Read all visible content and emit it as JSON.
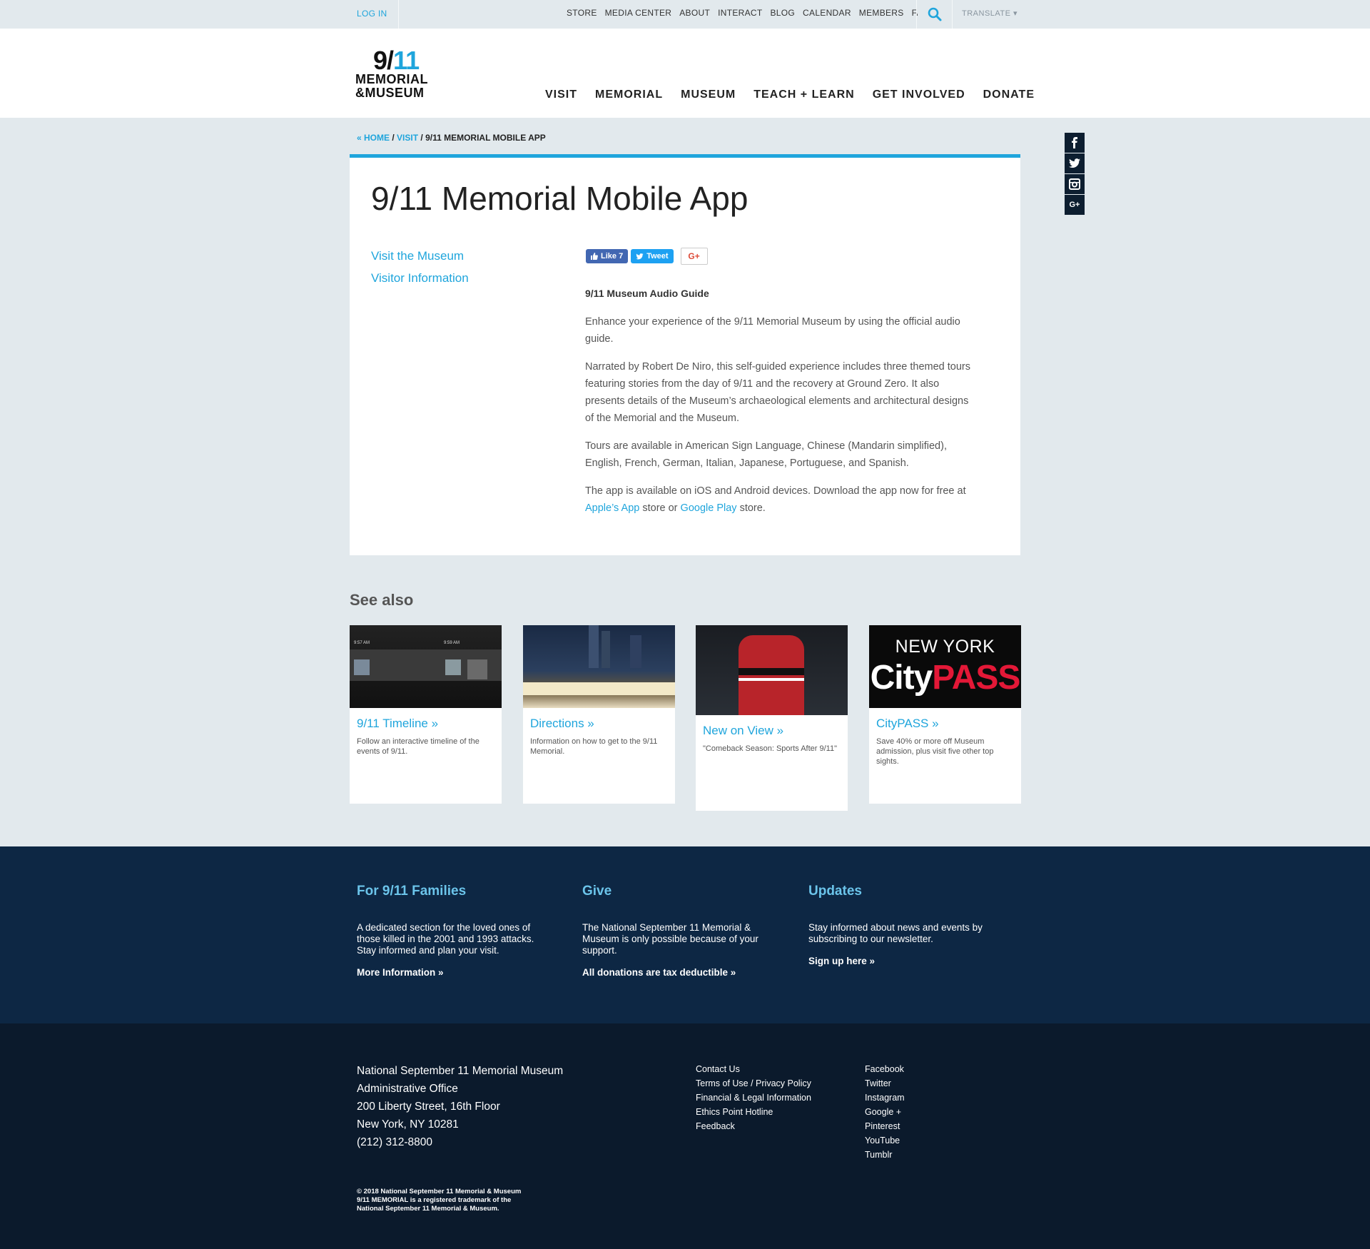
{
  "utility_bar": {
    "login": "LOG IN",
    "links": [
      "STORE",
      "MEDIA CENTER",
      "ABOUT",
      "INTERACT",
      "BLOG",
      "CALENDAR",
      "MEMBERS",
      "FAQ"
    ],
    "translate": "TRANSLATE ▾"
  },
  "logo": {
    "line1a": "9/",
    "line1b": "11",
    "line2": "MEMORIAL",
    "line3": "&MUSEUM"
  },
  "main_nav": [
    "VISIT",
    "MEMORIAL",
    "MUSEUM",
    "TEACH + LEARN",
    "GET INVOLVED",
    "DONATE"
  ],
  "breadcrumb": {
    "home": "« HOME",
    "visit": "VISIT",
    "current": "9/11 MEMORIAL MOBILE APP"
  },
  "social_side": [
    "f",
    "t",
    "ig",
    "G+"
  ],
  "page_title": "9/11 Memorial Mobile App",
  "side_links": [
    "Visit the Museum",
    "Visitor Information"
  ],
  "share": {
    "like": "Like 7",
    "tweet": "Tweet",
    "gplus": "G+"
  },
  "article": {
    "heading": "9/11 Museum Audio Guide",
    "p1": "Enhance your experience of the 9/11 Memorial Museum by using the official audio guide.",
    "p2": "Narrated by Robert De Niro, this self-guided experience includes three themed tours featuring stories from the day of 9/11 and the recovery at Ground Zero. It also presents details of the Museum’s archaeological elements and architectural designs of the Memorial and the Museum.",
    "p3": "Tours are available in American Sign Language, Chinese (Mandarin simplified), English, French, German, Italian, Japanese, Portuguese, and Spanish.",
    "p4_a": "The app is available on iOS and Android devices. Download the app now for free at ",
    "p4_link1": "Apple’s App",
    "p4_b": " store or ",
    "p4_link2": "Google Play",
    "p4_c": " store."
  },
  "see_also": {
    "title": "See also",
    "tiles": [
      {
        "title": "9/11 Timeline »",
        "desc": "Follow an interactive timeline of the events of 9/11.",
        "time1": "9:57 AM",
        "time2": "9:59 AM"
      },
      {
        "title": "Directions »",
        "desc": "Information on how to get to the 9/11 Memorial."
      },
      {
        "title": "New on View »",
        "desc": "\"Comeback Season: Sports After 9/11\""
      },
      {
        "title": "CityPASS »",
        "desc": "Save 40% or more off Museum admission, plus visit five other top sights.",
        "img_line1": "NEW YORK",
        "img_city": "City",
        "img_pass": "PASS"
      }
    ]
  },
  "footer_top": [
    {
      "title": "For 9/11 Families",
      "text": "A dedicated section for the loved ones of those killed in the 2001 and 1993 attacks. Stay informed and plan your visit.",
      "link": "More Information »"
    },
    {
      "title": "Give",
      "text": "The National September 11 Memorial & Museum is only possible because of your support.",
      "link": "All donations are tax deductible »"
    },
    {
      "title": "Updates",
      "text": "Stay informed about news and events by subscribing to our newsletter.",
      "link": "Sign up here »"
    }
  ],
  "footer_bottom": {
    "address": [
      "National September 11 Memorial Museum",
      "Administrative Office",
      "200 Liberty Street, 16th Floor",
      "New York, NY 10281",
      "(212) 312-8800"
    ],
    "links1": [
      "Contact Us",
      "Terms of Use / Privacy Policy",
      "Financial & Legal Information",
      "Ethics Point Hotline",
      "Feedback"
    ],
    "links2": [
      "Facebook",
      "Twitter",
      "Instagram",
      "Google +",
      "Pinterest",
      "YouTube",
      "Tumblr"
    ],
    "copyright": [
      "© 2018 National September 11 Memorial & Museum",
      "9/11 MEMORIAL is a registered trademark of the",
      "National September 11 Memorial & Museum."
    ]
  },
  "colors": {
    "accent": "#1fa5dc",
    "footer_top": "#0d2744",
    "footer_bottom": "#0b1a2c",
    "page_bg": "#e2e9ed"
  }
}
